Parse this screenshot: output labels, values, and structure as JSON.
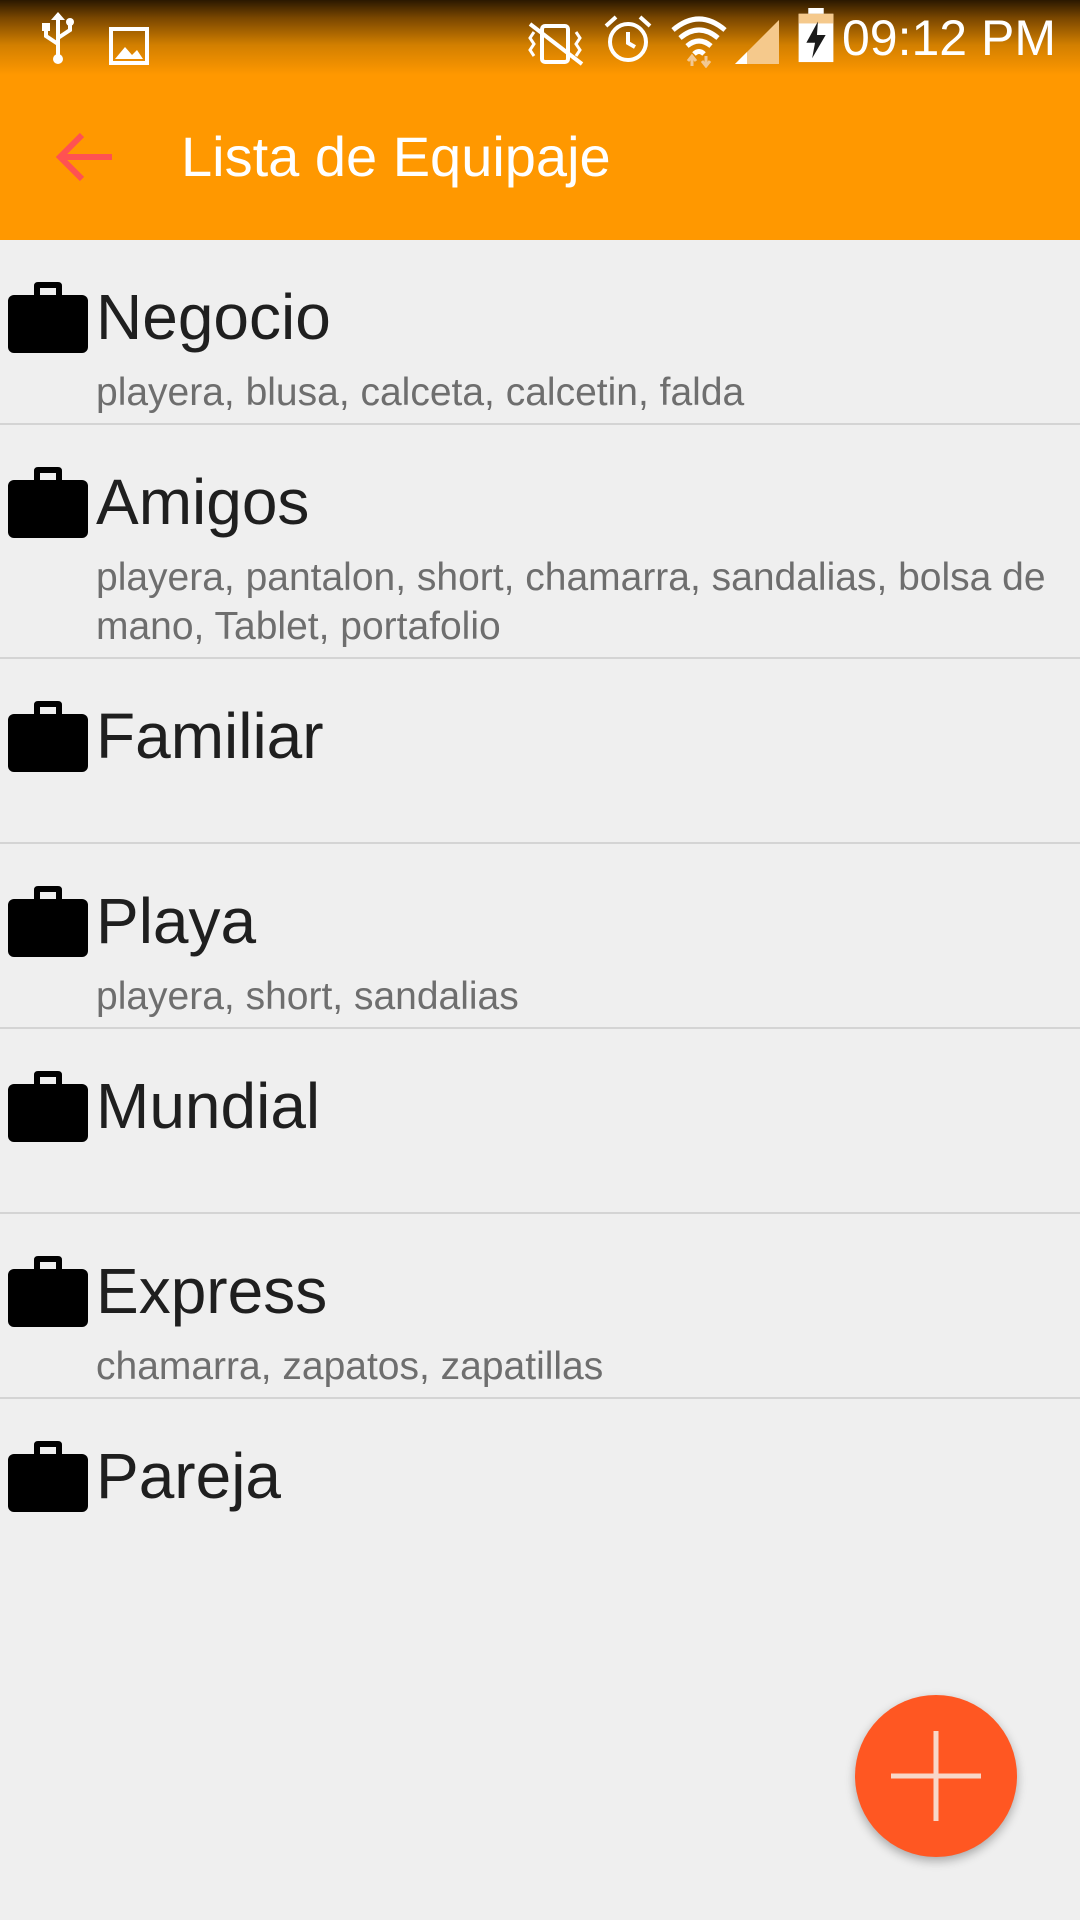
{
  "status_bar": {
    "time": "09:12 PM",
    "icons": [
      "usb-icon",
      "image-icon",
      "vibrate-mute-icon",
      "alarm-icon",
      "wifi-icon",
      "signal-icon",
      "battery-charging-icon"
    ]
  },
  "app_bar": {
    "title": "Lista de Equipaje",
    "back_icon": "arrow-back-icon",
    "back_icon_color": "#ff5252",
    "background_color": "#ff9800"
  },
  "list": {
    "item_icon": "briefcase-icon",
    "items": [
      {
        "title": "Negocio",
        "subtitle": "playera, blusa, calceta, calcetin, falda"
      },
      {
        "title": "Amigos",
        "subtitle": "playera, pantalon, short, chamarra, sandalias, bolsa de mano, Tablet, portafolio"
      },
      {
        "title": "Familiar",
        "subtitle": ""
      },
      {
        "title": "Playa",
        "subtitle": "playera, short, sandalias"
      },
      {
        "title": "Mundial",
        "subtitle": ""
      },
      {
        "title": "Express",
        "subtitle": "chamarra, zapatos, zapatillas"
      },
      {
        "title": "Pareja",
        "subtitle": ""
      }
    ]
  },
  "fab": {
    "icon": "plus-icon",
    "color": "#ff5722"
  }
}
